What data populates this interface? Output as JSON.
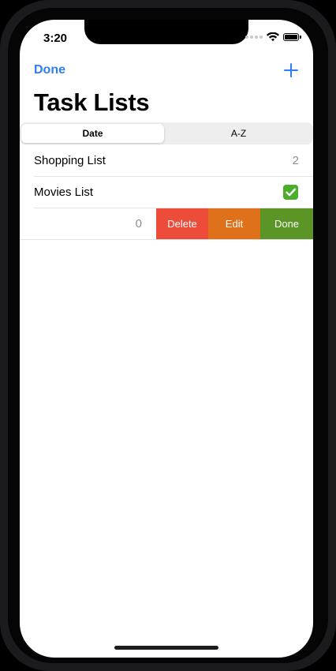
{
  "status_bar": {
    "time": "3:20"
  },
  "nav": {
    "done_label": "Done",
    "add_icon": "plus-icon",
    "title": "Task Lists"
  },
  "segmented_control": {
    "options": [
      "Date",
      "A-Z"
    ],
    "selected": "Date"
  },
  "lists": [
    {
      "name": "Shopping List",
      "count": "2"
    },
    {
      "name": "Movies List",
      "status_icon": "checkmark-box-icon"
    },
    {
      "name": "",
      "count": "0",
      "swiped": true
    }
  ],
  "swipe_actions": [
    {
      "label": "Delete",
      "color": "#ee4c3a"
    },
    {
      "label": "Edit",
      "color": "#e0711b"
    },
    {
      "label": "Done",
      "color": "#5b9526"
    }
  ],
  "colors": {
    "accent": "#2f7cf6",
    "check": "#4cae2a"
  }
}
